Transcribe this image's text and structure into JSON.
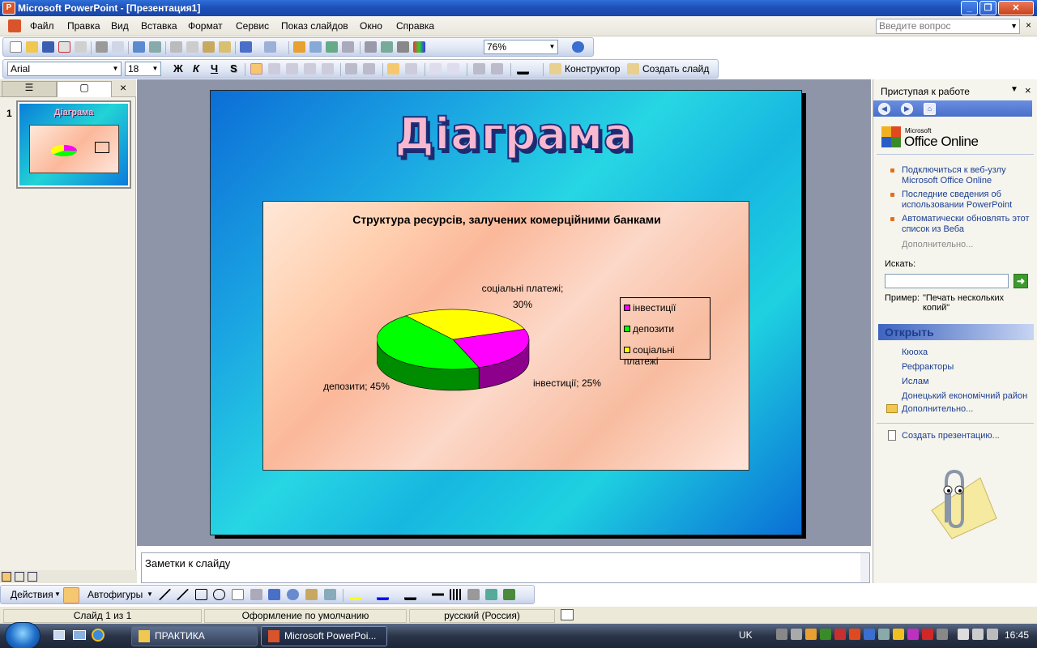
{
  "window": {
    "title": "Microsoft PowerPoint - [Презентация1]",
    "app_icon": "powerpoint-icon",
    "controls": [
      "minimize-icon",
      "restore-icon",
      "close-icon"
    ]
  },
  "menu": {
    "items": [
      "Файл",
      "Правка",
      "Вид",
      "Вставка",
      "Формат",
      "Сервис",
      "Показ слайдов",
      "Окно",
      "Справка"
    ],
    "ask_placeholder": "Введите вопрос",
    "close_glyph": "×"
  },
  "toolbar_standard": {
    "zoom": "76%"
  },
  "toolbar_format": {
    "font": "Arial",
    "size": "18",
    "bold": "Ж",
    "italic": "К",
    "underline": "Ч",
    "shadow": "S",
    "designer": "Конструктор",
    "new_slide": "Создать слайд"
  },
  "slides_pane": {
    "slide_number": "1",
    "close_glyph": "×"
  },
  "slide": {
    "title": "Діаграма",
    "chart_title": "Структура ресурсів, залучених комерційними банками"
  },
  "chart_data": {
    "type": "pie",
    "title": "Структура ресурсів, залучених комерційними банками",
    "categories": [
      "інвестиції",
      "депозити",
      "соціальні платежі"
    ],
    "values": [
      25,
      45,
      30
    ],
    "unit": "%",
    "colors": [
      "#ff00ff",
      "#00ff00",
      "#ffff00"
    ],
    "data_labels": [
      "інвестиції; 25%",
      "депозити; 45%",
      "соціальні платежі; 30%"
    ],
    "legend_position": "right",
    "three_d": true
  },
  "notes": {
    "placeholder": "Заметки к слайду"
  },
  "task_pane": {
    "title": "Приступая к работе",
    "logo_small": "Microsoft",
    "logo": "Office Online",
    "links": [
      "Подключиться к веб-узлу Microsoft Office Online",
      "Последние сведения об использовании PowerPoint",
      "Автоматически обновлять этот список из Веба"
    ],
    "more": "Дополнительно...",
    "search_label": "Искать:",
    "example_label": "Пример:",
    "example_text": "\"Печать нескольких копий\"",
    "open_header": "Открыть",
    "recent": [
      "Кюоха",
      "Рефракторы",
      "Ислам",
      "Донецький економічний район"
    ],
    "open_more": "Дополнительно...",
    "create": "Создать презентацию..."
  },
  "drawing_toolbar": {
    "actions": "Действия",
    "autoshapes": "Автофигуры"
  },
  "status": {
    "slide": "Слайд 1 из 1",
    "design": "Оформление по умолчанию",
    "language": "русский (Россия)"
  },
  "taskbar": {
    "tasks": [
      "ПРАКТИКА",
      "Microsoft PowerPoi..."
    ],
    "keyboard": "UK",
    "clock": "16:45"
  }
}
